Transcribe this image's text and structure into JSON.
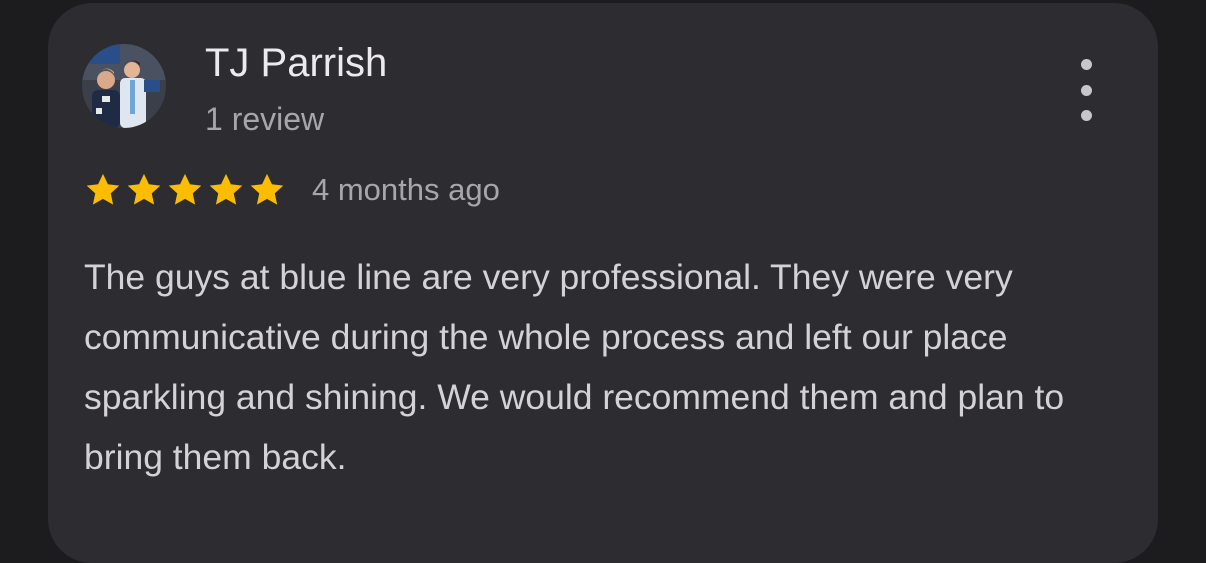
{
  "review": {
    "author_name": "TJ Parrish",
    "author_meta": "1 review",
    "rating": 5,
    "rating_max": 5,
    "time_ago": "4 months ago",
    "text": "The guys at blue line are very professional. They were very communicative during the whole process and left our place sparkling and shining. We would recommend them and plan to bring them back.",
    "star_color": "#fbbc04"
  },
  "menu": {
    "icon": "more-vert-icon"
  }
}
